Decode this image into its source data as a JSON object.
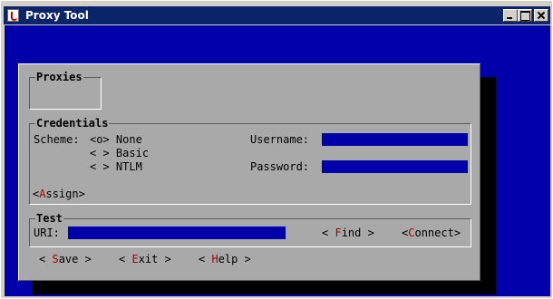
{
  "window": {
    "title": "Proxy Tool"
  },
  "proxies": {
    "title": "Proxies"
  },
  "credentials": {
    "title": "Credentials",
    "scheme_label": "Scheme:",
    "options": [
      {
        "marker": "<o>",
        "label": "None"
      },
      {
        "marker": "< >",
        "label": "Basic"
      },
      {
        "marker": "< >",
        "label": "NTLM"
      }
    ],
    "username_label": "Username:",
    "username_value": "",
    "password_label": "Password:",
    "password_value": "",
    "assign": {
      "pre": "<",
      "hot": "A",
      "post": "ssign>"
    }
  },
  "test": {
    "title": "Test",
    "uri_label": "URI:",
    "uri_value": "",
    "find": {
      "pre": "< ",
      "hot": "F",
      "post": "ind >"
    },
    "connect": {
      "pre": "<",
      "hot": "C",
      "post": "onnect>"
    }
  },
  "footer": {
    "save": {
      "pre": "< ",
      "hot": "S",
      "post": "ave >"
    },
    "exit": {
      "pre": "< ",
      "hot": "E",
      "post": "xit >"
    },
    "help": {
      "pre": "< ",
      "hot": "H",
      "post": "elp >"
    }
  },
  "colors": {
    "desktop": "#0000aa",
    "dialog": "#aaa9aa",
    "titlebar": "#0a246a",
    "hotkey": "#aa0000",
    "field": "#0000aa"
  }
}
